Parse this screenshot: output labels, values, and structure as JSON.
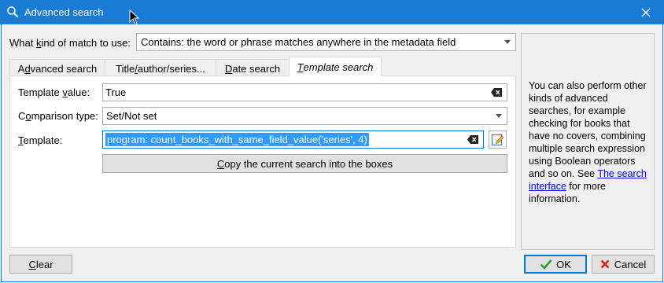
{
  "window": {
    "title": "Advanced search",
    "close_glyph": "✕"
  },
  "match": {
    "label_pre": "What ",
    "label_key": "k",
    "label_post": "ind of match to use:",
    "value": "Contains: the word or phrase matches anywhere in the metadata field"
  },
  "tabs": [
    {
      "pre": "A",
      "key": "d",
      "post": "vanced search"
    },
    {
      "pre": "Title",
      "key": "/",
      "post": "author/series..."
    },
    {
      "pre": "",
      "key": "D",
      "post": "ate search"
    },
    {
      "pre": "",
      "key": "T",
      "post": "emplate search"
    }
  ],
  "template_tab": {
    "value_label_pre": "Template ",
    "value_label_key": "v",
    "value_label_post": "alue:",
    "value": "True",
    "comparison_label_pre": "C",
    "comparison_label_key": "o",
    "comparison_label_post": "mparison type:",
    "comparison_value": "Set/Not set",
    "template_label_pre": "",
    "template_label_key": "T",
    "template_label_post": "emplate:",
    "template_value": "program: count_books_with_same_field_value('series', 4)",
    "copy_pre": "",
    "copy_key": "C",
    "copy_post": "opy the current search into the boxes"
  },
  "help": {
    "text_before": "You can also perform other kinds of advanced searches, for example checking for books that have no covers, combining multiple search expression using Boolean operators and so on. See ",
    "link": "The search interface",
    "text_after": " for more information."
  },
  "footer": {
    "clear_key": "C",
    "clear_post": "lear",
    "ok_label": "OK",
    "cancel_label": "Cancel"
  },
  "colors": {
    "titlebar": "#1a7bd5",
    "selection": "#3399ff",
    "ok_icon": "#2e9e2e",
    "cancel_icon": "#d11f1f"
  },
  "icons": {
    "app": "search-icon",
    "close": "close-icon",
    "clear_field": "backspace-clear-icon",
    "edit_template": "edit-icon",
    "ok": "checkmark-icon",
    "cancel": "x-icon",
    "cursor": "mouse-cursor-icon"
  }
}
